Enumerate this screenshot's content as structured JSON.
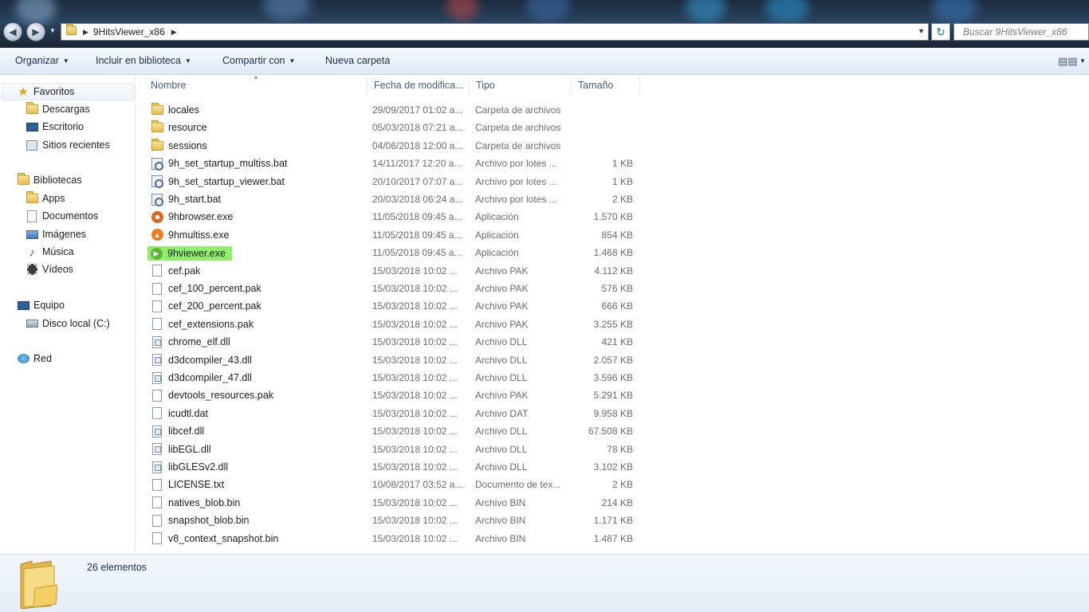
{
  "address": {
    "path": "9HitsViewer_x86",
    "search_placeholder": "Buscar 9HitsViewer_x86"
  },
  "toolbar": {
    "organize": "Organizar",
    "include_library": "Incluir en biblioteca",
    "share_with": "Compartir con",
    "new_folder": "Nueva carpeta"
  },
  "sidebar": {
    "favorites": "Favoritos",
    "downloads": "Descargas",
    "desktop": "Escritorio",
    "recent": "Sitios recientes",
    "libraries": "Bibliotecas",
    "apps": "Apps",
    "documents": "Documentos",
    "images": "Imágenes",
    "music": "Música",
    "videos": "Vídeos",
    "computer": "Equipo",
    "local_disk": "Disco local (C:)",
    "network": "Red"
  },
  "columns": {
    "name": "Nombre",
    "date": "Fecha de modifica...",
    "type": "Tipo",
    "size": "Tamaño"
  },
  "files": [
    {
      "name": "locales",
      "date": "29/09/2017 01:02 a...",
      "type": "Carpeta de archivos",
      "size": "",
      "icon": "folder-icon"
    },
    {
      "name": "resource",
      "date": "05/03/2018 07:21 a...",
      "type": "Carpeta de archivos",
      "size": "",
      "icon": "folder-icon"
    },
    {
      "name": "sessions",
      "date": "04/06/2018 12:00 a...",
      "type": "Carpeta de archivos",
      "size": "",
      "icon": "folder-icon"
    },
    {
      "name": "9h_set_startup_multiss.bat",
      "date": "14/11/2017 12:20 a...",
      "type": "Archivo por lotes ...",
      "size": "1 KB",
      "icon": "batch-file-icon"
    },
    {
      "name": "9h_set_startup_viewer.bat",
      "date": "20/10/2017 07:07 a...",
      "type": "Archivo por lotes ...",
      "size": "1 KB",
      "icon": "batch-file-icon"
    },
    {
      "name": "9h_start.bat",
      "date": "20/03/2018 06:24 a...",
      "type": "Archivo por lotes ...",
      "size": "2 KB",
      "icon": "batch-file-icon"
    },
    {
      "name": "9hbrowser.exe",
      "date": "11/05/2018 09:45 a...",
      "type": "Aplicación",
      "size": "1.570 KB",
      "icon": "browser-app-icon"
    },
    {
      "name": "9hmultiss.exe",
      "date": "11/05/2018 09:45 a...",
      "type": "Aplicación",
      "size": "854 KB",
      "icon": "multiss-app-icon"
    },
    {
      "name": "9hviewer.exe",
      "date": "11/05/2018 09:45 a...",
      "type": "Aplicación",
      "size": "1.468 KB",
      "icon": "viewer-app-icon"
    },
    {
      "name": "cef.pak",
      "date": "15/03/2018 10:02 ...",
      "type": "Archivo PAK",
      "size": "4.112 KB",
      "icon": "file-icon"
    },
    {
      "name": "cef_100_percent.pak",
      "date": "15/03/2018 10:02 ...",
      "type": "Archivo PAK",
      "size": "576 KB",
      "icon": "file-icon"
    },
    {
      "name": "cef_200_percent.pak",
      "date": "15/03/2018 10:02 ...",
      "type": "Archivo PAK",
      "size": "666 KB",
      "icon": "file-icon"
    },
    {
      "name": "cef_extensions.pak",
      "date": "15/03/2018 10:02 ...",
      "type": "Archivo PAK",
      "size": "3.255 KB",
      "icon": "file-icon"
    },
    {
      "name": "chrome_elf.dll",
      "date": "15/03/2018 10:02 ...",
      "type": "Archivo DLL",
      "size": "421 KB",
      "icon": "dll-file-icon"
    },
    {
      "name": "d3dcompiler_43.dll",
      "date": "15/03/2018 10:02 ...",
      "type": "Archivo DLL",
      "size": "2.057 KB",
      "icon": "dll-file-icon"
    },
    {
      "name": "d3dcompiler_47.dll",
      "date": "15/03/2018 10:02 ...",
      "type": "Archivo DLL",
      "size": "3.596 KB",
      "icon": "dll-file-icon"
    },
    {
      "name": "devtools_resources.pak",
      "date": "15/03/2018 10:02 ...",
      "type": "Archivo PAK",
      "size": "5.291 KB",
      "icon": "file-icon"
    },
    {
      "name": "icudtl.dat",
      "date": "15/03/2018 10:02 ...",
      "type": "Archivo DAT",
      "size": "9.958 KB",
      "icon": "file-icon"
    },
    {
      "name": "libcef.dll",
      "date": "15/03/2018 10:02 ...",
      "type": "Archivo DLL",
      "size": "67.508 KB",
      "icon": "dll-file-icon"
    },
    {
      "name": "libEGL.dll",
      "date": "15/03/2018 10:02 ...",
      "type": "Archivo DLL",
      "size": "78 KB",
      "icon": "dll-file-icon"
    },
    {
      "name": "libGLESv2.dll",
      "date": "15/03/2018 10:02 ...",
      "type": "Archivo DLL",
      "size": "3.102 KB",
      "icon": "dll-file-icon"
    },
    {
      "name": "LICENSE.txt",
      "date": "10/08/2017 03:52 a...",
      "type": "Documento de tex...",
      "size": "2 KB",
      "icon": "text-file-icon"
    },
    {
      "name": "natives_blob.bin",
      "date": "15/03/2018 10:02 ...",
      "type": "Archivo BIN",
      "size": "214 KB",
      "icon": "file-icon"
    },
    {
      "name": "snapshot_blob.bin",
      "date": "15/03/2018 10:02 ...",
      "type": "Archivo BIN",
      "size": "1.171 KB",
      "icon": "file-icon"
    },
    {
      "name": "v8_context_snapshot.bin",
      "date": "15/03/2018 10:02 ...",
      "type": "Archivo BIN",
      "size": "1.487 KB",
      "icon": "file-icon"
    }
  ],
  "highlighted_file": "9hviewer.exe",
  "highlight_color": "#90ee6a",
  "status": {
    "count": "26 elementos"
  }
}
